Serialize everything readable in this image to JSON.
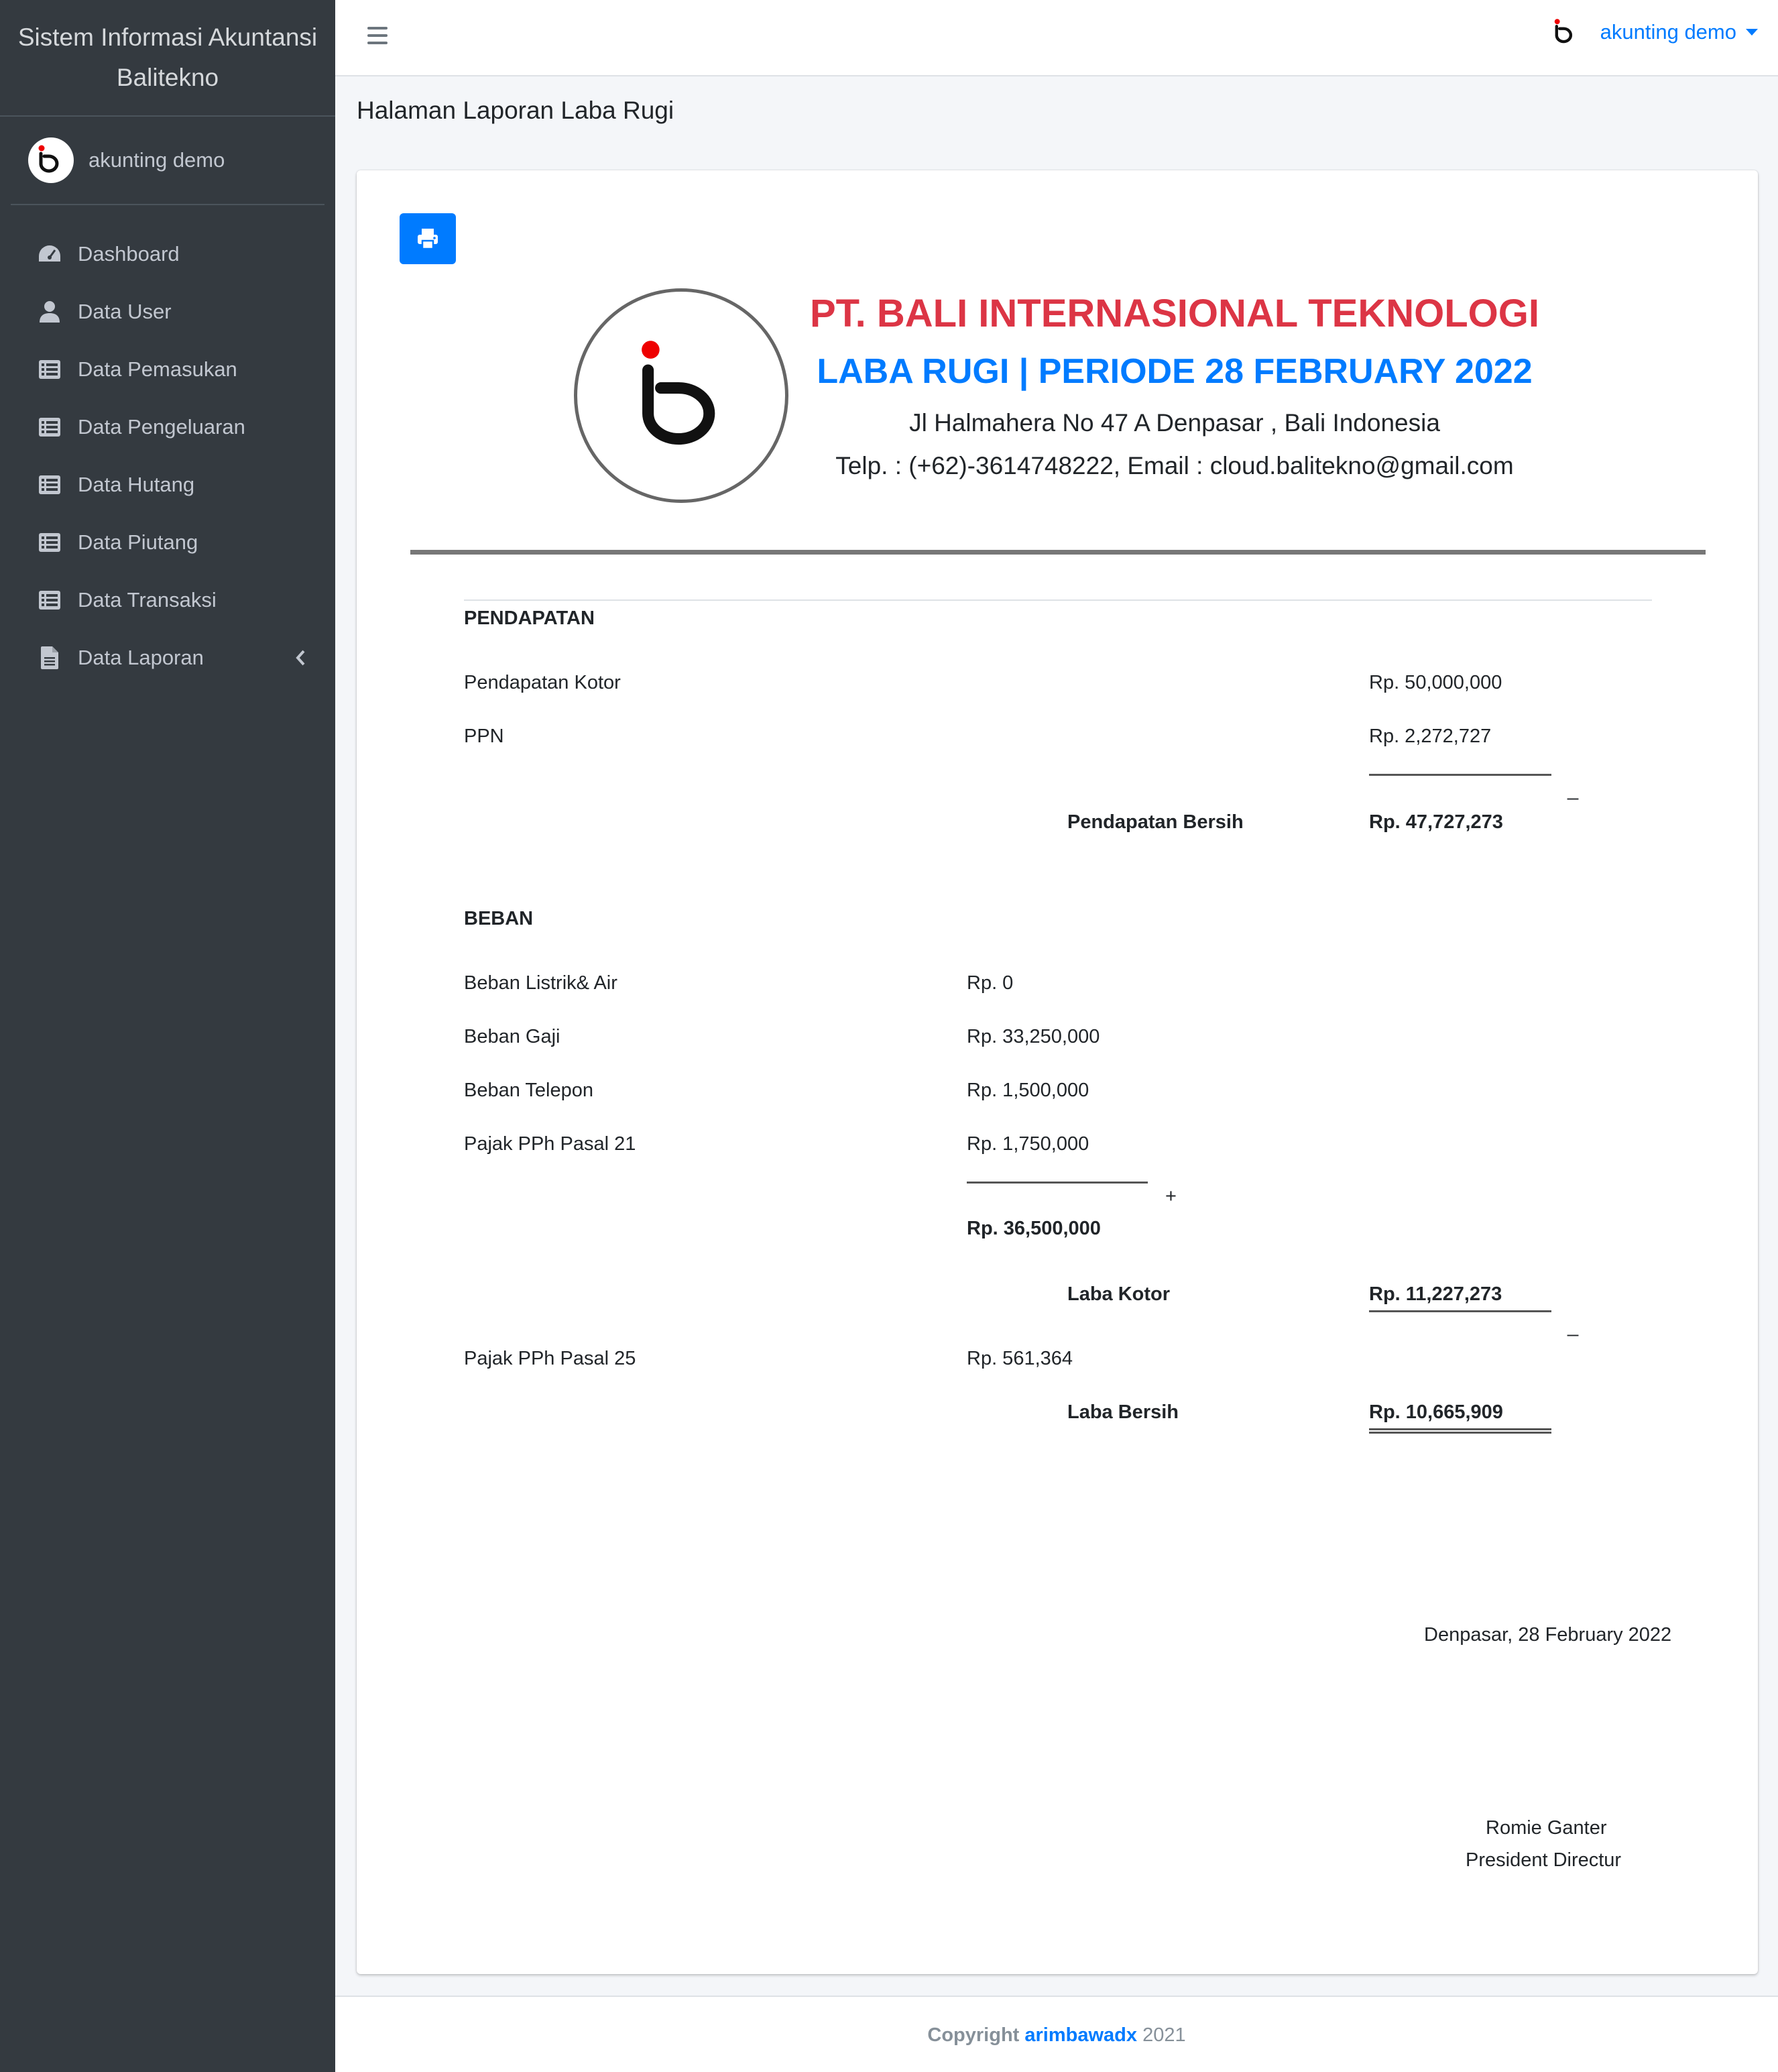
{
  "sidebar": {
    "brand_line1": "Sistem Informasi Akuntansi",
    "brand_line2": "Balitekno",
    "user_name": "akunting demo",
    "items": [
      {
        "label": "Dashboard",
        "icon": "tachometer-icon"
      },
      {
        "label": "Data User",
        "icon": "user-icon"
      },
      {
        "label": "Data Pemasukan",
        "icon": "list-icon"
      },
      {
        "label": "Data Pengeluaran",
        "icon": "list-icon"
      },
      {
        "label": "Data Hutang",
        "icon": "list-icon"
      },
      {
        "label": "Data Piutang",
        "icon": "list-icon"
      },
      {
        "label": "Data Transaksi",
        "icon": "list-icon"
      },
      {
        "label": "Data Laporan",
        "icon": "file-icon"
      }
    ]
  },
  "navbar": {
    "user_name": "akunting demo"
  },
  "page": {
    "heading": "Halaman Laporan Laba Rugi"
  },
  "report": {
    "company_name": "PT. BALI INTERNASIONAL TEKNOLOGI",
    "period": "LABA RUGI | PERIODE 28 FEBRUARY 2022",
    "address": "Jl Halmahera No 47 A Denpasar , Bali Indonesia",
    "contact": "Telp. : (+62)-3614748222, Email : cloud.balitekno@gmail.com",
    "income": {
      "section": "PENDAPATAN",
      "gross_label": "Pendapatan Kotor",
      "gross_value": "Rp. 50,000,000",
      "vat_label": "PPN",
      "vat_value": "Rp. 2,272,727",
      "minus_sign": "_",
      "net_label": "Pendapatan Bersih",
      "net_value": "Rp. 47,727,273"
    },
    "expense": {
      "section": "BEBAN",
      "items": [
        {
          "label": "Beban Listrik& Air",
          "value": "Rp. 0"
        },
        {
          "label": "Beban Gaji",
          "value": "Rp. 33,250,000"
        },
        {
          "label": "Beban Telepon",
          "value": "Rp. 1,500,000"
        },
        {
          "label": "Pajak PPh Pasal 21",
          "value": "Rp. 1,750,000"
        }
      ],
      "plus_sign": "+",
      "total_value": "Rp. 36,500,000"
    },
    "gross_profit_label": "Laba Kotor",
    "gross_profit_value": "Rp. 11,227,273",
    "minus_sign2": "_",
    "tax25_label": "Pajak PPh Pasal 25",
    "tax25_value": "Rp. 561,364",
    "net_profit_label": "Laba Bersih",
    "net_profit_value": "Rp. 10,665,909",
    "place_date": "Denpasar, 28 February 2022",
    "signer_name": "Romie Ganter",
    "signer_title": "President Directur"
  },
  "footer": {
    "copyright": "Copyright",
    "author": "arimbawadx",
    "year": "2021"
  },
  "colors": {
    "sidebar_bg": "#343a40",
    "primary": "#007bff",
    "danger": "#dc3545"
  }
}
